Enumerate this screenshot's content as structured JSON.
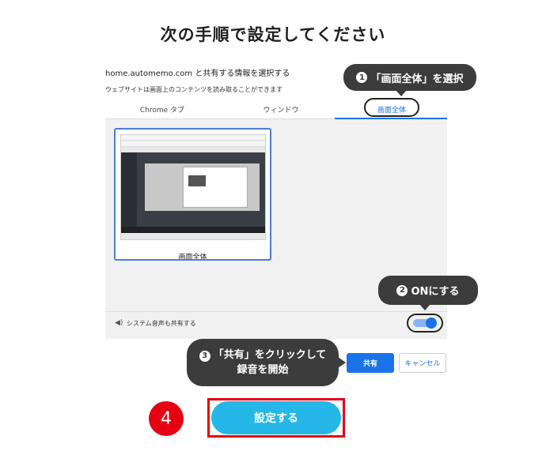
{
  "title": "次の手順で設定してください",
  "dialog": {
    "prompt": "home.automemo.com と共有する情報を選択する",
    "description": "ウェブサイトは画面上のコンテンツを読み取ることができます",
    "tabs": [
      {
        "label": "Chrome タブ"
      },
      {
        "label": "ウィンドウ"
      },
      {
        "label": "画面全体"
      }
    ],
    "thumbnail_label": "画面全体",
    "audio_label": "システム音声も共有する",
    "audio_icon": "speaker-icon",
    "share_label": "共有",
    "cancel_label": "キャンセル"
  },
  "callouts": {
    "step1_num": "1",
    "step1_text": "「画面全体」を選択",
    "step2_num": "2",
    "step2_text": "ONにする",
    "step3_num": "3",
    "step3_line1": "「共有」をクリックして",
    "step3_line2": "録音を開始"
  },
  "step4": {
    "num": "4",
    "button_label": "設定する"
  },
  "colors": {
    "accent": "#1a73e8",
    "callout": "#3c3c3c",
    "step_red": "#e60012",
    "save_button": "#25b7e8"
  }
}
